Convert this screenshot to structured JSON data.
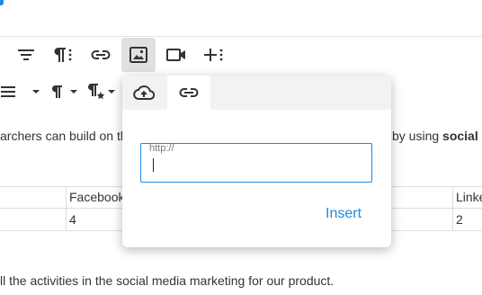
{
  "content": {
    "paragraph_1_left": "archers can build on th",
    "paragraph_1_right": "by using",
    "paragraph_1_bold": "social",
    "paragraph_2": "ll the activities in the social media marketing for our product."
  },
  "table": {
    "headers": [
      "Facebook",
      "Linke"
    ],
    "rows": [
      [
        "4",
        "2"
      ]
    ]
  },
  "popup": {
    "url_placeholder": "http://",
    "url_value": "",
    "insert_label": "Insert"
  }
}
